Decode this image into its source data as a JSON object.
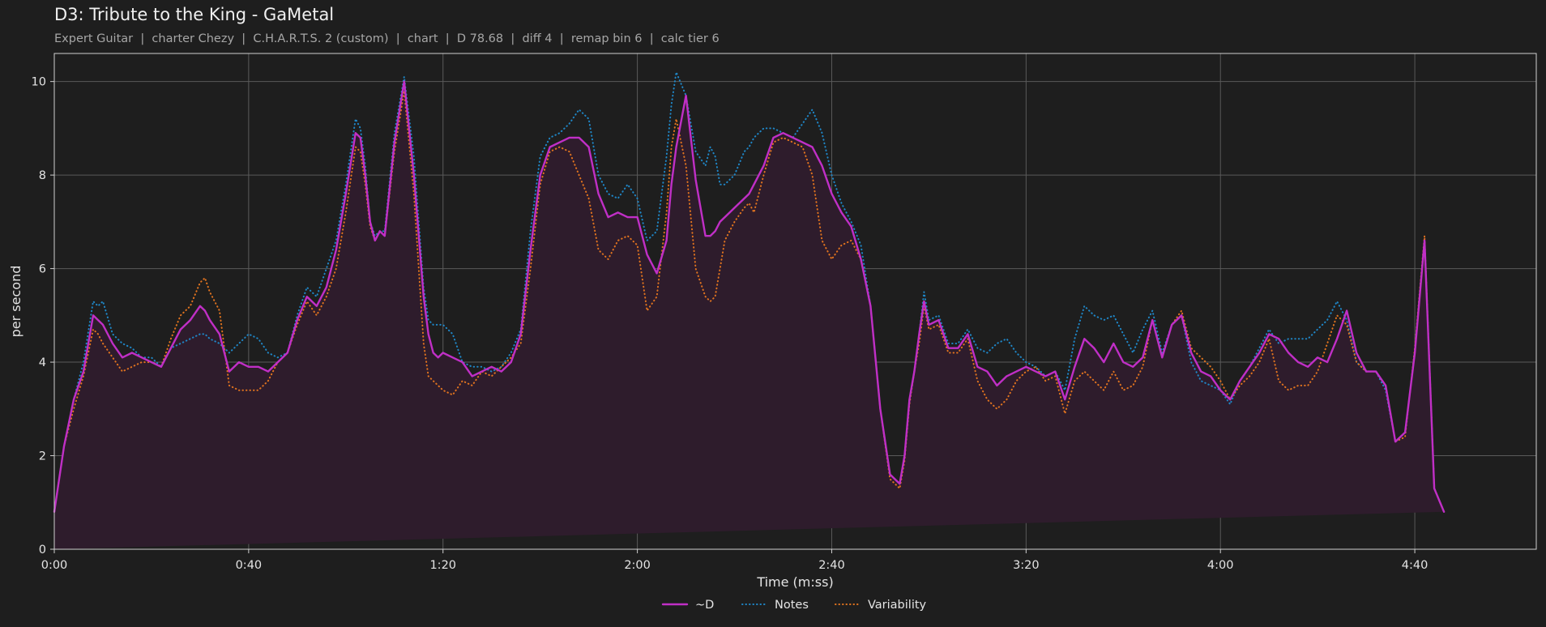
{
  "title": "D3: Tribute to the King - GaMetal",
  "subtitle": "Expert Guitar  |  charter Chezy  |  C.H.A.R.T.S. 2 (custom)  |  chart  |  D 78.68  |  diff 4  |  remap bin 6  |  calc tier 6",
  "colors": {
    "background": "#1e1e1e",
    "grid": "#5a5a5a",
    "fill": "#2e1c2c",
    "d": "#c02fc6",
    "notes": "#1f86c6",
    "variability": "#e0731f"
  },
  "chart_data": {
    "type": "line",
    "xlabel": "Time (m:ss)",
    "ylabel": "per second",
    "xlim": [
      0,
      305
    ],
    "ylim": [
      0,
      10.6
    ],
    "grid": true,
    "legend_placement": "bottom-center",
    "xticks": [
      {
        "value": 0,
        "label": "0:00"
      },
      {
        "value": 40,
        "label": "0:40"
      },
      {
        "value": 80,
        "label": "1:20"
      },
      {
        "value": 120,
        "label": "2:00"
      },
      {
        "value": 160,
        "label": "2:40"
      },
      {
        "value": 200,
        "label": "3:20"
      },
      {
        "value": 240,
        "label": "4:00"
      },
      {
        "value": 280,
        "label": "4:40"
      }
    ],
    "yticks": [
      {
        "value": 0,
        "label": "0"
      },
      {
        "value": 2,
        "label": "2"
      },
      {
        "value": 4,
        "label": "4"
      },
      {
        "value": 6,
        "label": "6"
      },
      {
        "value": 8,
        "label": "8"
      },
      {
        "value": 10,
        "label": "10"
      }
    ],
    "x": [
      0,
      2,
      4,
      6,
      8,
      9,
      10,
      12,
      14,
      16,
      18,
      20,
      22,
      24,
      26,
      28,
      30,
      31,
      32,
      34,
      36,
      38,
      40,
      42,
      44,
      46,
      48,
      50,
      52,
      54,
      56,
      58,
      60,
      62,
      63,
      64,
      65,
      66,
      67,
      68,
      70,
      72,
      74,
      76,
      77,
      78,
      79,
      80,
      82,
      84,
      86,
      88,
      90,
      92,
      94,
      96,
      98,
      100,
      102,
      104,
      106,
      108,
      110,
      112,
      114,
      116,
      118,
      120,
      122,
      124,
      126,
      127,
      128,
      130,
      132,
      134,
      135,
      136,
      137,
      138,
      140,
      142,
      143,
      144,
      146,
      148,
      150,
      152,
      154,
      156,
      158,
      160,
      162,
      164,
      166,
      168,
      170,
      172,
      174,
      175,
      176,
      177,
      178,
      179,
      180,
      182,
      184,
      186,
      188,
      190,
      192,
      194,
      196,
      198,
      200,
      202,
      204,
      206,
      208,
      210,
      212,
      214,
      216,
      218,
      220,
      222,
      224,
      226,
      228,
      230,
      232,
      234,
      236,
      238,
      240,
      242,
      244,
      246,
      248,
      250,
      252,
      254,
      256,
      258,
      260,
      262,
      264,
      266,
      268,
      270,
      272,
      274,
      276,
      278,
      280,
      282,
      284,
      286,
      288,
      290,
      292,
      294,
      296,
      297,
      298,
      300,
      302,
      304,
      305
    ],
    "series": [
      {
        "name": "~D",
        "style": "solid",
        "values": [
          0.8,
          2.2,
          3.2,
          3.8,
          5.0,
          4.9,
          4.8,
          4.4,
          4.1,
          4.2,
          4.1,
          4.0,
          3.9,
          4.3,
          4.7,
          4.9,
          5.2,
          5.1,
          4.9,
          4.6,
          3.8,
          4.0,
          3.9,
          3.9,
          3.8,
          4.0,
          4.2,
          4.9,
          5.4,
          5.2,
          5.6,
          6.4,
          7.6,
          8.9,
          8.8,
          8.0,
          7.0,
          6.6,
          6.8,
          6.7,
          8.7,
          10.0,
          8.0,
          5.4,
          4.6,
          4.2,
          4.1,
          4.2,
          4.1,
          4.0,
          3.7,
          3.8,
          3.9,
          3.8,
          4.0,
          4.6,
          6.4,
          8.0,
          8.6,
          8.7,
          8.8,
          8.8,
          8.6,
          7.6,
          7.1,
          7.2,
          7.1,
          7.1,
          6.3,
          5.9,
          6.6,
          7.8,
          8.6,
          9.7,
          7.9,
          6.7,
          6.7,
          6.8,
          7.0,
          7.1,
          7.3,
          7.5,
          7.6,
          7.8,
          8.2,
          8.8,
          8.9,
          8.8,
          8.7,
          8.6,
          8.2,
          7.6,
          7.2,
          6.9,
          6.2,
          5.2,
          3.0,
          1.6,
          1.4,
          2.0,
          3.2,
          3.8,
          4.6,
          5.3,
          4.8,
          4.9,
          4.3,
          4.3,
          4.6,
          3.9,
          3.8,
          3.5,
          3.7,
          3.8,
          3.9,
          3.8,
          3.7,
          3.8,
          3.2,
          3.9,
          4.5,
          4.3,
          4.0,
          4.4,
          4.0,
          3.9,
          4.1,
          4.9,
          4.1,
          4.8,
          5.0,
          4.2,
          3.8,
          3.7,
          3.4,
          3.2,
          3.6,
          3.9,
          4.2,
          4.6,
          4.5,
          4.2,
          4.0,
          3.9,
          4.1,
          4.0,
          4.5,
          5.1,
          4.2,
          3.8,
          3.8,
          3.5,
          2.3,
          2.5,
          4.2,
          6.6,
          1.3,
          0.8
        ]
      },
      {
        "name": "Notes",
        "style": "dotted",
        "values": [
          0.8,
          2.2,
          3.2,
          4.0,
          5.3,
          5.2,
          5.3,
          4.6,
          4.4,
          4.3,
          4.1,
          4.1,
          3.9,
          4.3,
          4.4,
          4.5,
          4.6,
          4.6,
          4.5,
          4.4,
          4.2,
          4.4,
          4.6,
          4.5,
          4.2,
          4.1,
          4.2,
          5.0,
          5.6,
          5.4,
          6.0,
          6.6,
          7.8,
          9.2,
          9.0,
          8.2,
          7.0,
          6.7,
          6.8,
          6.8,
          8.9,
          10.1,
          8.4,
          5.6,
          4.9,
          4.8,
          4.8,
          4.8,
          4.6,
          4.0,
          3.9,
          3.9,
          3.8,
          3.9,
          4.2,
          4.7,
          6.8,
          8.4,
          8.8,
          8.9,
          9.1,
          9.4,
          9.2,
          8.0,
          7.6,
          7.5,
          7.8,
          7.5,
          6.6,
          6.8,
          8.4,
          9.5,
          10.2,
          9.7,
          8.5,
          8.2,
          8.6,
          8.4,
          7.8,
          7.8,
          8.0,
          8.5,
          8.6,
          8.8,
          9.0,
          9.0,
          8.9,
          8.8,
          9.1,
          9.4,
          8.9,
          8.0,
          7.4,
          7.0,
          6.5,
          5.2,
          3.0,
          1.6,
          1.4,
          2.0,
          3.2,
          3.8,
          4.6,
          5.5,
          4.9,
          5.0,
          4.4,
          4.4,
          4.7,
          4.3,
          4.2,
          4.4,
          4.5,
          4.2,
          4.0,
          3.9,
          3.7,
          3.8,
          3.4,
          4.5,
          5.2,
          5.0,
          4.9,
          5.0,
          4.6,
          4.2,
          4.7,
          5.1,
          4.2,
          4.8,
          5.0,
          4.0,
          3.6,
          3.5,
          3.4,
          3.1,
          3.6,
          3.9,
          4.3,
          4.7,
          4.4,
          4.5,
          4.5,
          4.5,
          4.7,
          4.9,
          5.3,
          4.9,
          4.0,
          3.8,
          3.8,
          3.4,
          2.3,
          2.5,
          4.2,
          6.6,
          1.3,
          0.8
        ]
      },
      {
        "name": "Variability",
        "style": "dotted",
        "values": [
          0.8,
          2.2,
          3.0,
          3.7,
          4.7,
          4.6,
          4.4,
          4.1,
          3.8,
          3.9,
          4.0,
          4.0,
          3.9,
          4.5,
          5.0,
          5.2,
          5.7,
          5.8,
          5.5,
          5.1,
          3.5,
          3.4,
          3.4,
          3.4,
          3.6,
          4.0,
          4.2,
          4.8,
          5.3,
          5.0,
          5.4,
          6.0,
          7.2,
          8.6,
          8.5,
          7.8,
          6.9,
          6.6,
          6.8,
          6.7,
          8.5,
          9.8,
          7.6,
          4.4,
          3.7,
          3.6,
          3.5,
          3.4,
          3.3,
          3.6,
          3.5,
          3.8,
          3.7,
          3.9,
          4.1,
          4.4,
          6.0,
          7.8,
          8.5,
          8.6,
          8.5,
          8.0,
          7.5,
          6.4,
          6.2,
          6.6,
          6.7,
          6.5,
          5.1,
          5.4,
          7.2,
          8.6,
          9.2,
          8.2,
          6.0,
          5.4,
          5.3,
          5.4,
          6.0,
          6.6,
          7.0,
          7.3,
          7.4,
          7.2,
          8.0,
          8.7,
          8.8,
          8.7,
          8.6,
          8.0,
          6.6,
          6.2,
          6.5,
          6.6,
          6.2,
          5.2,
          3.0,
          1.5,
          1.3,
          1.9,
          3.1,
          3.8,
          4.4,
          5.2,
          4.7,
          4.8,
          4.2,
          4.2,
          4.5,
          3.6,
          3.2,
          3.0,
          3.2,
          3.6,
          3.8,
          3.9,
          3.6,
          3.7,
          2.9,
          3.6,
          3.8,
          3.6,
          3.4,
          3.8,
          3.4,
          3.5,
          3.9,
          4.9,
          4.1,
          4.8,
          5.1,
          4.3,
          4.1,
          3.9,
          3.6,
          3.2,
          3.5,
          3.7,
          4.0,
          4.5,
          3.6,
          3.4,
          3.5,
          3.5,
          3.8,
          4.4,
          5.0,
          4.8,
          4.0,
          3.8,
          3.8,
          3.5,
          2.3,
          2.4,
          4.3,
          6.7,
          1.3,
          0.8
        ]
      }
    ]
  }
}
